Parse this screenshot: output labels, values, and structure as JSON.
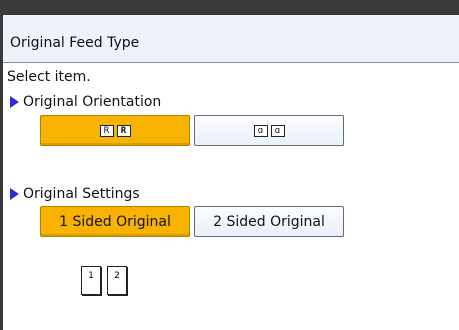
{
  "header": {
    "title": "Original Feed Type"
  },
  "prompt": "Select item.",
  "orientation": {
    "title": "Original Orientation",
    "options": [
      {
        "label": "R R",
        "selected": true,
        "icon": "readable-orientation-icon"
      },
      {
        "label": "rotated",
        "selected": false,
        "icon": "unreadable-orientation-icon"
      }
    ]
  },
  "settings": {
    "title": "Original Settings",
    "options": [
      {
        "label": "1 Sided Original",
        "selected": true
      },
      {
        "label": "2 Sided Original",
        "selected": false
      }
    ]
  },
  "preview": {
    "pages": [
      "1",
      "2"
    ]
  },
  "colors": {
    "selected": "#f8b300",
    "accent_triangle": "#2c2cd8",
    "header_bg": "#eef2fa"
  }
}
